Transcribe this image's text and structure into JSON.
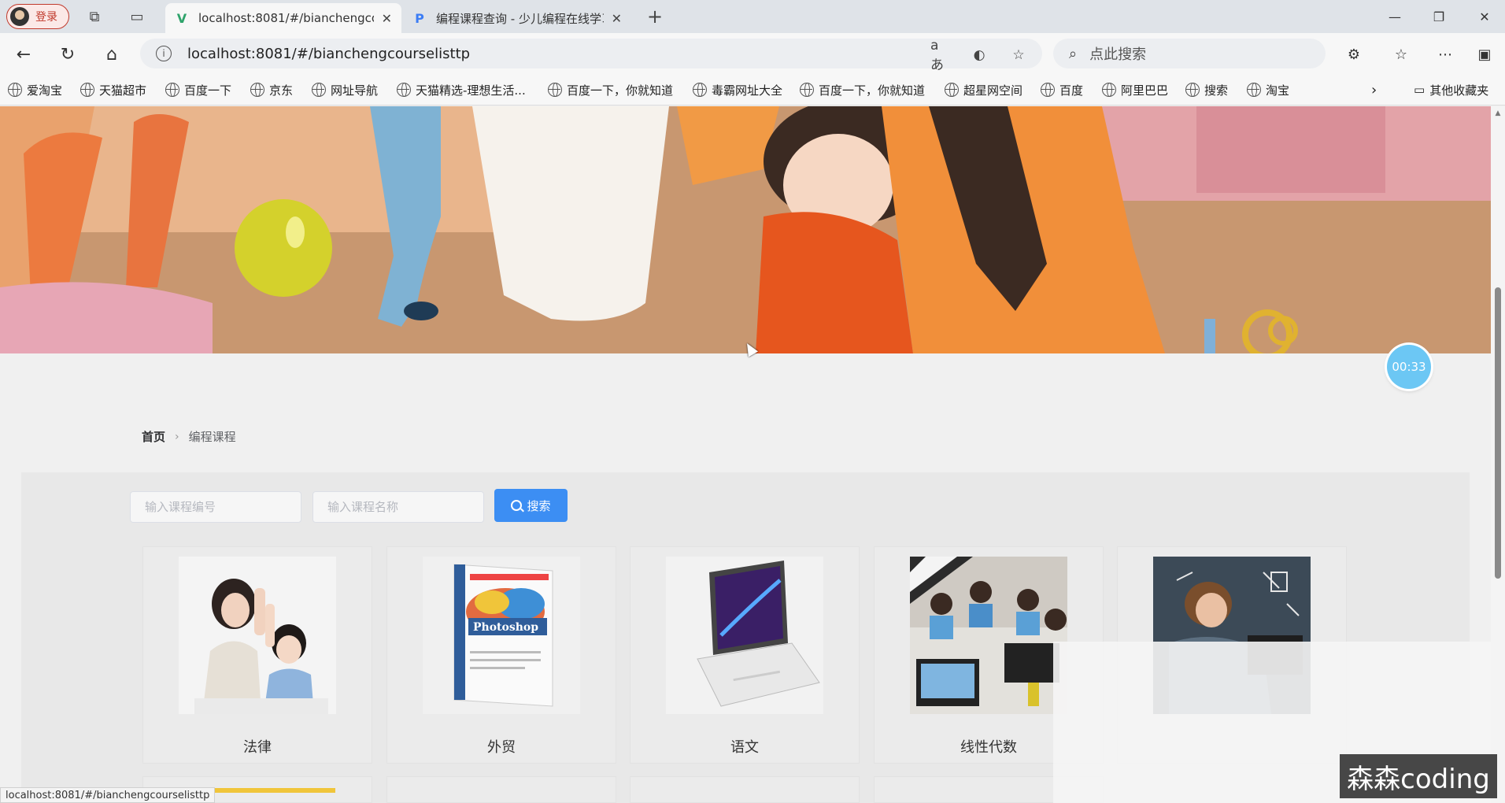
{
  "browser": {
    "profile_label": "登录",
    "tabs": [
      {
        "title": "localhost:8081/#/bianchengcours",
        "active": true
      },
      {
        "title": "编程课程查询 - 少儿编程在线学习",
        "active": false
      }
    ],
    "url": "localhost:8081/#/bianchengcourselisttp",
    "search_placeholder": "点此搜索",
    "bookmarks": [
      "爱淘宝",
      "天猫超市",
      "百度一下",
      "京东",
      "网址导航",
      "天猫精选-理想生活...",
      "百度一下，你就知道",
      "毒霸网址大全",
      "百度一下，你就知道",
      "超星网空间",
      "百度",
      "阿里巴巴",
      "搜索",
      "淘宝"
    ],
    "other_bookmarks": "其他收藏夹",
    "status_url": "localhost:8081/#/bianchengcourselisttp"
  },
  "page": {
    "timer": "00:33",
    "breadcrumb": {
      "home": "首页",
      "current": "编程课程"
    },
    "search": {
      "code_placeholder": "输入课程编号",
      "name_placeholder": "输入课程名称",
      "button_label": "搜索"
    },
    "courses": [
      {
        "title": "法律",
        "image": "teacher-child-highfive"
      },
      {
        "title": "外贸",
        "image": "photoshop-book"
      },
      {
        "title": "语文",
        "image": "laptop"
      },
      {
        "title": "线性代数",
        "image": "kids-computer-class"
      },
      {
        "title": "",
        "image": "kid-chalkboard"
      }
    ]
  },
  "watermark": "森森coding",
  "colors": {
    "accent": "#3c8ef3",
    "timer": "#6cc7f4",
    "banner": "#c5936d"
  }
}
